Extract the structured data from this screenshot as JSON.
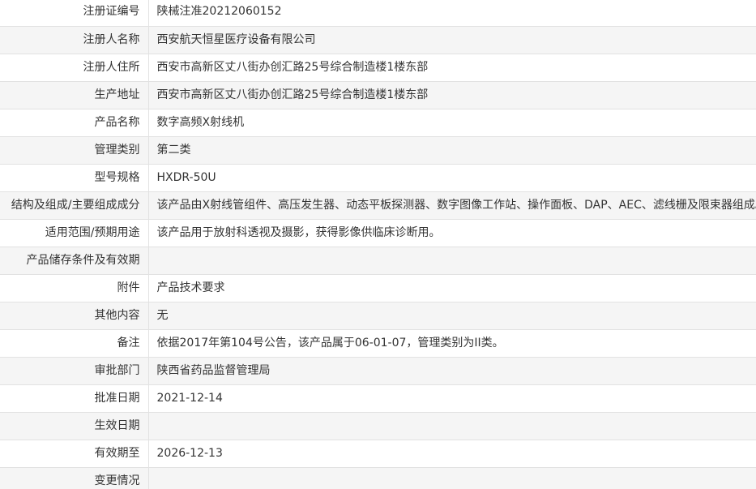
{
  "rows": [
    {
      "label": "注册证编号",
      "value": "陕械注准20212060152"
    },
    {
      "label": "注册人名称",
      "value": "西安航天恒星医疗设备有限公司"
    },
    {
      "label": "注册人住所",
      "value": "西安市高新区丈八街办创汇路25号综合制造楼1楼东部"
    },
    {
      "label": "生产地址",
      "value": "西安市高新区丈八街办创汇路25号综合制造楼1楼东部"
    },
    {
      "label": "产品名称",
      "value": "数字高频X射线机"
    },
    {
      "label": "管理类别",
      "value": "第二类"
    },
    {
      "label": "型号规格",
      "value": "HXDR-50U"
    },
    {
      "label": "结构及组成/主要组成成分",
      "value": "该产品由X射线管组件、高压发生器、动态平板探测器、数字图像工作站、操作面板、DAP、AEC、滤线栅及限束器组成。"
    },
    {
      "label": "适用范围/预期用途",
      "value": "该产品用于放射科透视及摄影，获得影像供临床诊断用。"
    },
    {
      "label": "产品储存条件及有效期",
      "value": ""
    },
    {
      "label": "附件",
      "value": "产品技术要求"
    },
    {
      "label": "其他内容",
      "value": "无"
    },
    {
      "label": "备注",
      "value": "依据2017年第104号公告，该产品属于06-01-07，管理类别为II类。"
    },
    {
      "label": "审批部门",
      "value": "陕西省药品监督管理局"
    },
    {
      "label": "批准日期",
      "value": "2021-12-14"
    },
    {
      "label": "生效日期",
      "value": ""
    },
    {
      "label": "有效期至",
      "value": "2026-12-13"
    },
    {
      "label": "变更情况",
      "value": ""
    }
  ]
}
